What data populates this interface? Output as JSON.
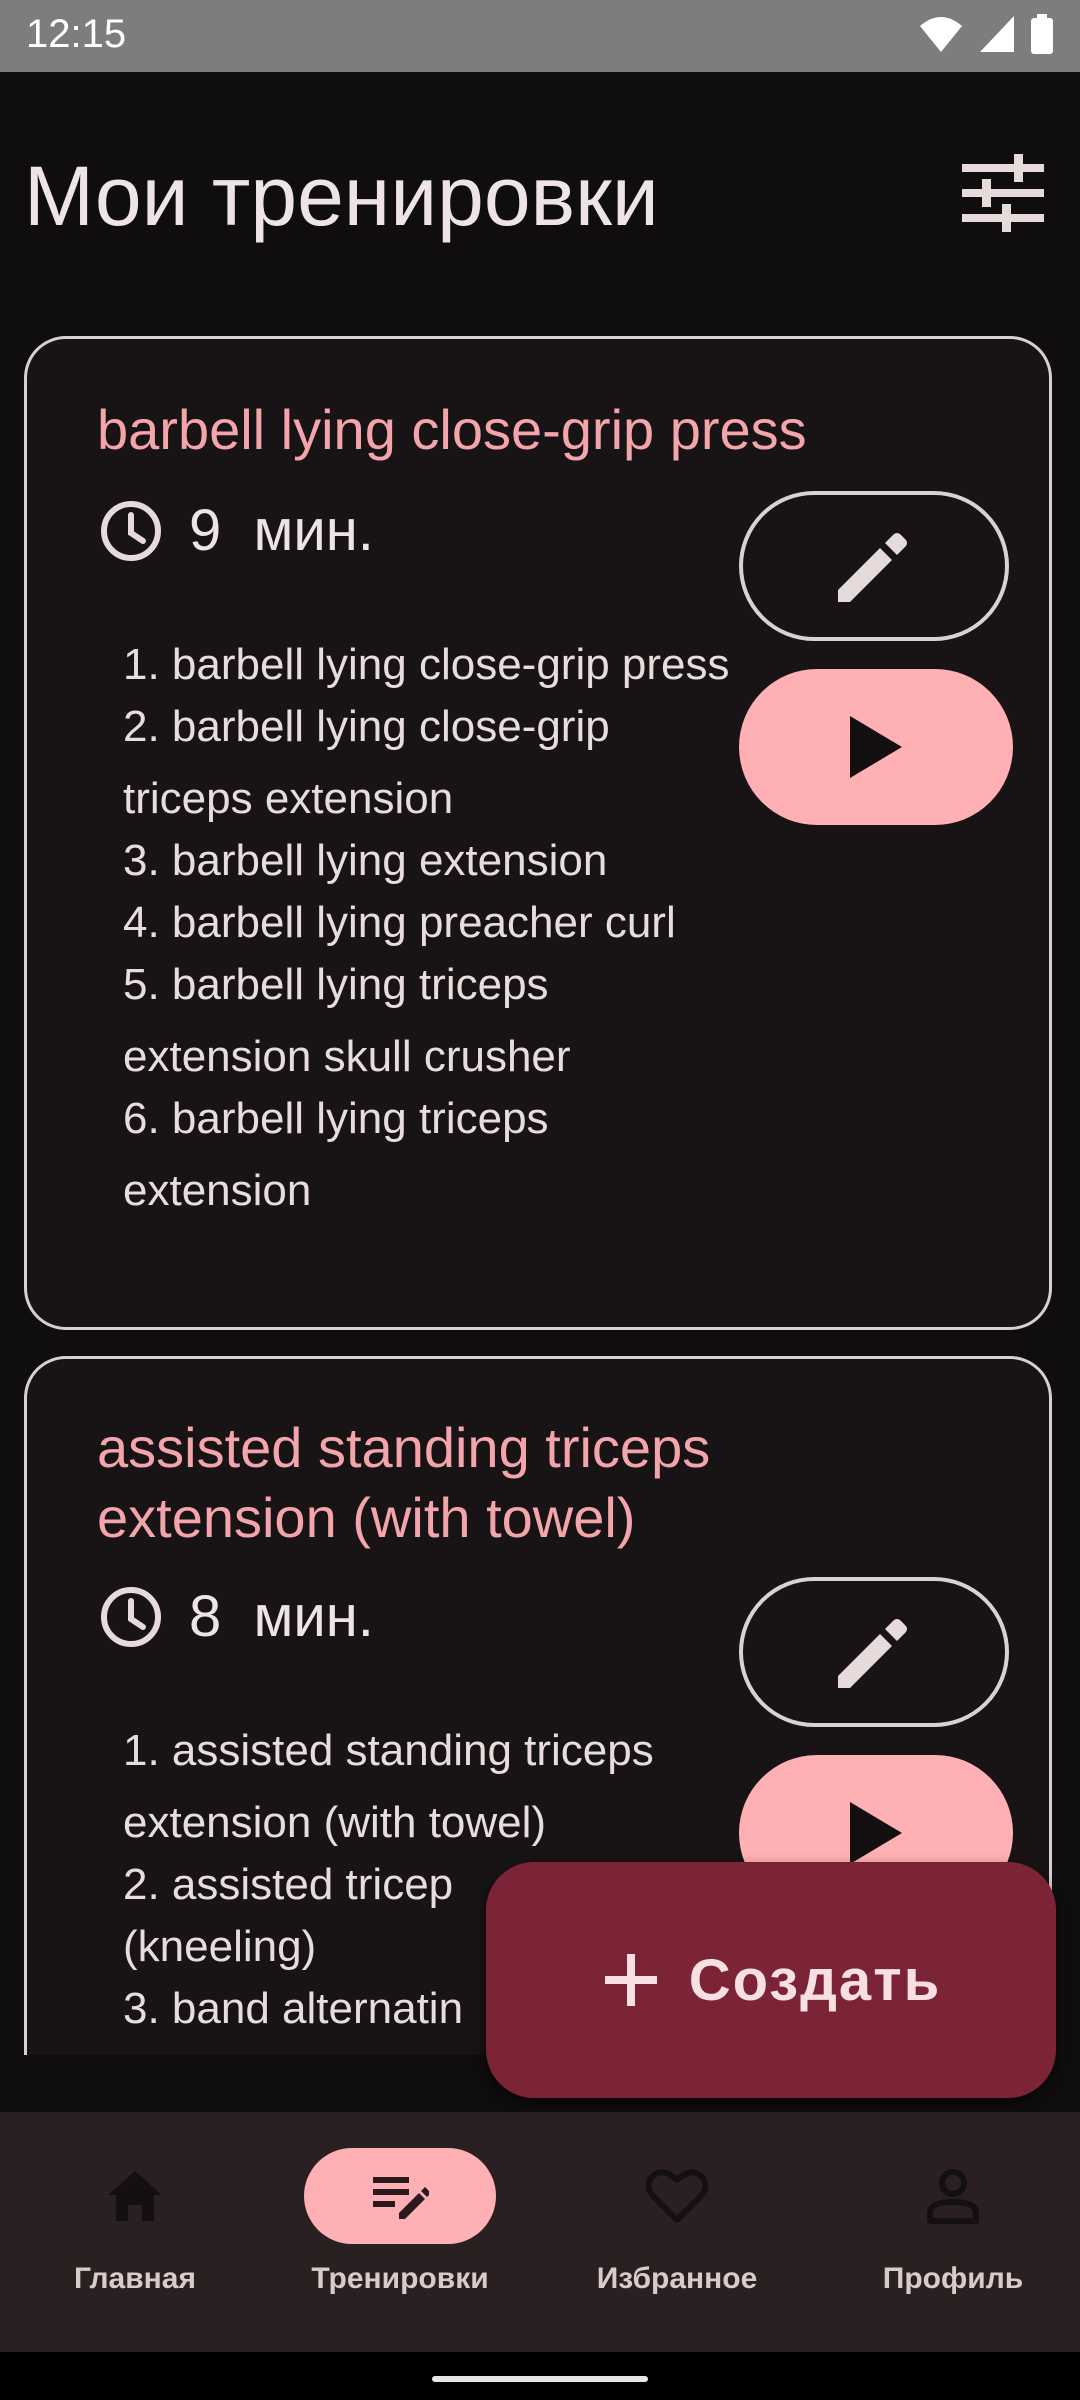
{
  "status_bar": {
    "time": "12:15"
  },
  "header": {
    "title": "Мои тренировки",
    "filter_icon": "tune-icon"
  },
  "workouts": [
    {
      "title": "barbell lying close-grip press",
      "duration_value": "9",
      "duration_unit": "мин.",
      "exercises": [
        "1. barbell lying close-grip press",
        "2. barbell lying close-grip triceps extension",
        "3. barbell lying extension",
        "4. barbell lying preacher curl",
        "5. barbell lying triceps extension skull crusher",
        "6. barbell lying triceps extension"
      ]
    },
    {
      "title": "assisted standing triceps extension (with towel)",
      "duration_value": "8",
      "duration_unit": "мин.",
      "exercises": [
        "1. assisted standing triceps extension (with towel)",
        "2. assisted tricep",
        "(kneeling)",
        "3. band alternatin"
      ]
    }
  ],
  "fab": {
    "label": "Создать",
    "icon": "plus-icon"
  },
  "bottom_nav": {
    "items": [
      {
        "label": "Главная",
        "icon": "home-icon",
        "active": false
      },
      {
        "label": "Тренировки",
        "icon": "workouts-edit-icon",
        "active": true
      },
      {
        "label": "Избранное",
        "icon": "heart-icon",
        "active": false
      },
      {
        "label": "Профиль",
        "icon": "person-icon",
        "active": false
      }
    ]
  },
  "colors": {
    "background": "#0f0d0e",
    "accent_pink": "#ffb0b5",
    "title_pink": "#f3a5ab",
    "fab_bg": "#7a2436",
    "nav_bg": "#2a2022"
  }
}
